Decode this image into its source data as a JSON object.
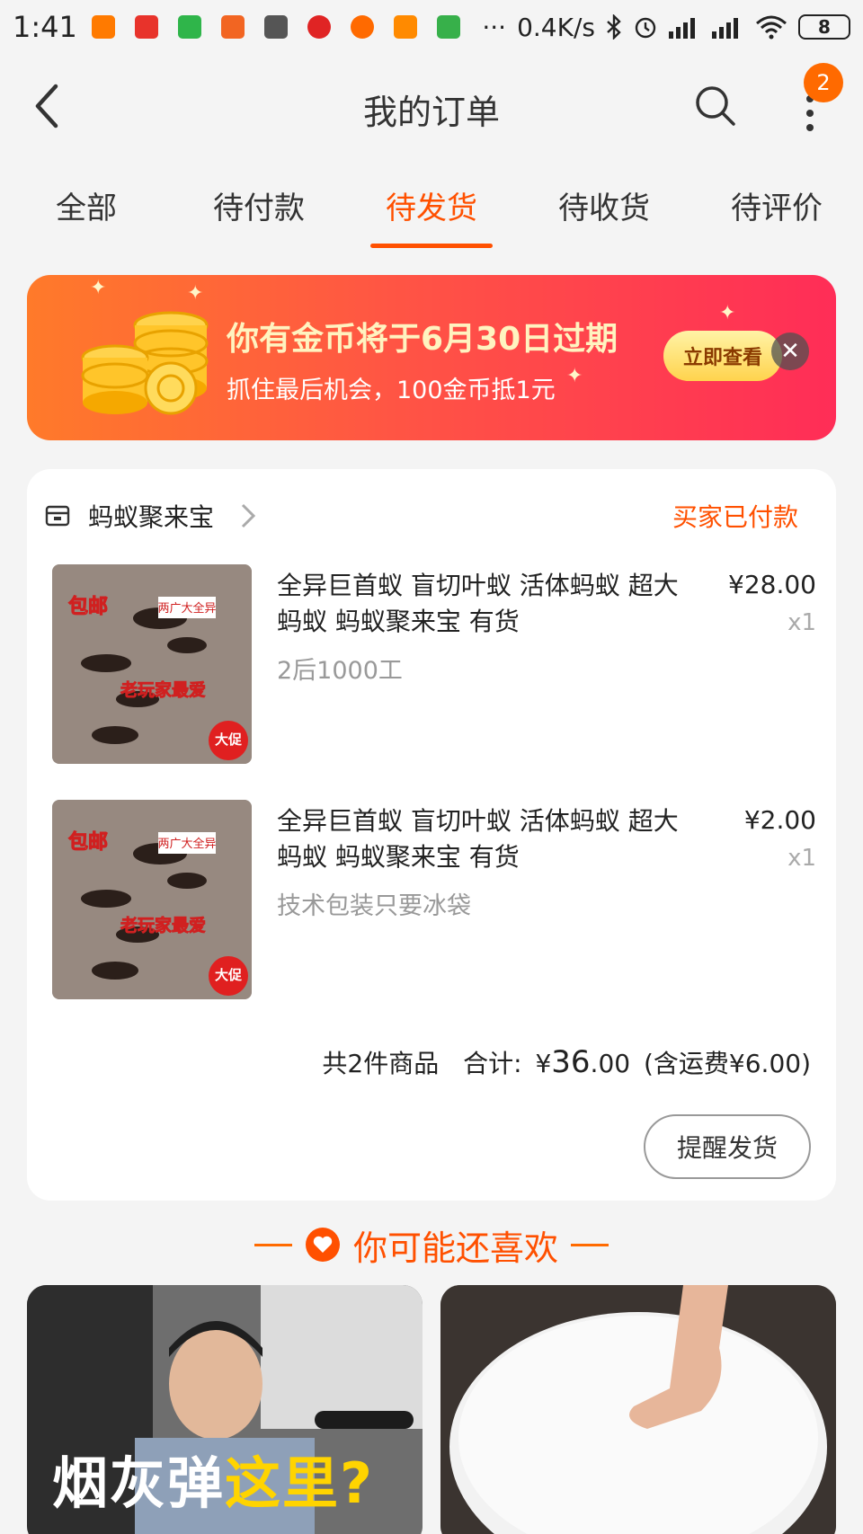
{
  "status_bar": {
    "time": "1:41",
    "network_speed": "0.4K/s",
    "battery_level": "8",
    "icons": [
      "bluetooth-icon",
      "alarm-icon",
      "signal-icon",
      "signal-icon",
      "wifi-icon"
    ],
    "app_icon_colors": [
      "#ff7a00",
      "#e8332b",
      "#2fb54a",
      "#f26522",
      "#555555",
      "#e02424",
      "#ff6a00",
      "#ff8a00",
      "#37b04a"
    ]
  },
  "nav": {
    "title": "我的订单",
    "badge_count": "2"
  },
  "tabs": [
    {
      "label": "全部"
    },
    {
      "label": "待付款"
    },
    {
      "label": "待发货"
    },
    {
      "label": "待收货"
    },
    {
      "label": "待评价"
    }
  ],
  "active_tab": "待发货",
  "banner": {
    "title": "你有金币将于6月30日过期",
    "subtitle": "抓住最后机会，100金币抵1元",
    "button_label": "立即查看",
    "close_glyph": "✕"
  },
  "order": {
    "shop_name": "蚂蚁聚来宝",
    "status": "买家已付款",
    "items": [
      {
        "title": "全异巨首蚁  盲切叶蚁 活体蚂蚁 超大蚂蚁   蚂蚁聚来宝 有货",
        "spec": "2后1000工",
        "price": "¥28.00",
        "qty": "x1"
      },
      {
        "title": "全异巨首蚁  盲切叶蚁 活体蚂蚁 超大蚂蚁   蚂蚁聚来宝 有货",
        "spec": "技术包装只要冰袋",
        "price": "¥2.00",
        "qty": "x1"
      }
    ],
    "thumb_texts": {
      "tag_free_shipping": "包邮",
      "tag_label": "两广大全异",
      "tag_slogan": "老玩家最爱",
      "tag_promo": "大促"
    },
    "summary": {
      "count_text": "共2件商品",
      "total_label": "合计:",
      "currency": "¥",
      "total_int": "36",
      "total_dec": ".00",
      "shipping": "(含运费¥6.00)"
    },
    "remind_button": "提醒发货"
  },
  "recommend": {
    "heading": "你可能还喜欢",
    "left_caption_a": "烟灰弹",
    "left_caption_b": "这里?"
  },
  "colors": {
    "accent": "#ff5000",
    "badge": "#ff6a00",
    "banner_gradient": [
      "#ff7a2a",
      "#ff5544",
      "#ff2d57"
    ]
  }
}
